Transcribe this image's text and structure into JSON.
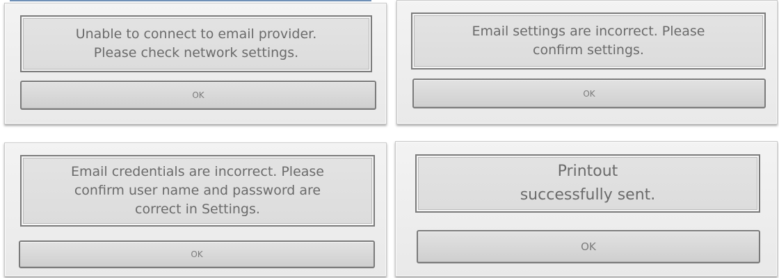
{
  "dialogs": [
    {
      "message": "Unable to connect to email provider.\nPlease check network settings.",
      "button_label": "OK"
    },
    {
      "message": "Email settings are incorrect.  Please\nconfirm settings.",
      "button_label": "OK"
    },
    {
      "message": "Email credentials are incorrect.  Please\nconfirm user name and password are\ncorrect in Settings.",
      "button_label": "OK"
    },
    {
      "message": "Printout\nsuccessfully sent.",
      "button_label": "OK"
    }
  ]
}
